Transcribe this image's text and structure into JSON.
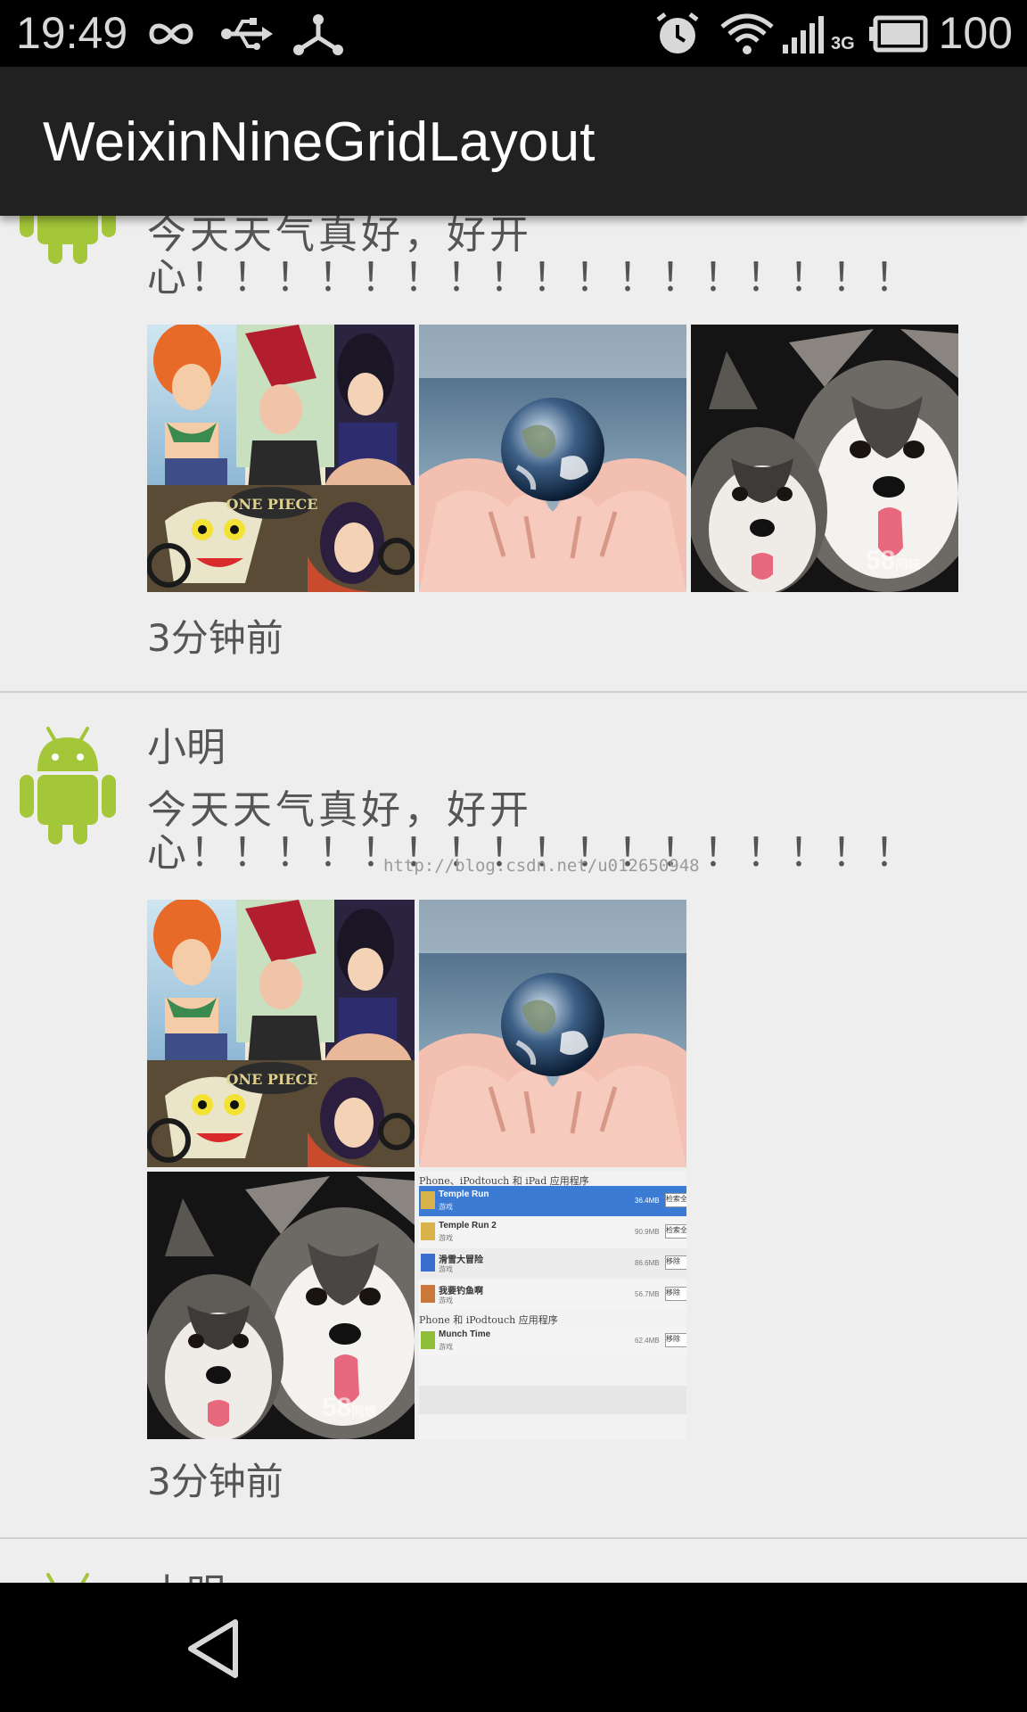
{
  "status_bar": {
    "time": "19:49",
    "battery_level": "100",
    "network_type": "3G",
    "icons": [
      "infinity-icon",
      "usb-icon",
      "share-icon",
      "alarm-icon",
      "wifi-icon",
      "signal-icon",
      "battery-icon"
    ]
  },
  "app_bar": {
    "title": "WeixinNineGridLayout"
  },
  "posts": [
    {
      "name": "",
      "content": "今天天气真好，好开心！！！！！！！！！！！！！！！！！",
      "time": "3分钟前",
      "images": [
        "anime-collage-image",
        "earth-in-hands-image",
        "husky-puppies-image"
      ]
    },
    {
      "name": "小明",
      "content": "今天天气真好，好开心！！！！！！！！！！！！！！！！！",
      "time": "3分钟前",
      "images": [
        "anime-collage-image",
        "earth-in-hands-image",
        "husky-puppies-image",
        "app-store-list-image"
      ]
    },
    {
      "name": "小明"
    }
  ],
  "watermark": "http://blog.csdn.net/u012650948",
  "puppy_watermark": "58",
  "puppy_watermark_sub": "同城",
  "puppy_watermark_dom": ".com",
  "app_list": {
    "header_1": "Phone、iPodtouch 和 iPad 应用程序",
    "header_2": "Phone 和 iPodtouch 应用程序",
    "items": [
      {
        "name": "Temple Run",
        "category": "游戏",
        "size": "36.4MB",
        "action": "检索全部",
        "selected": true
      },
      {
        "name": "Temple Run 2",
        "category": "游戏",
        "size": "90.9MB",
        "action": "检索全部",
        "selected": false
      },
      {
        "name": "滑雪大冒险",
        "category": "游戏",
        "size": "86.6MB",
        "action": "移除",
        "selected": false
      },
      {
        "name": "我要钓鱼啊",
        "category": "游戏",
        "size": "56.7MB",
        "action": "移除",
        "selected": false
      }
    ],
    "item_2": {
      "name": "Munch Time",
      "category": "游戏",
      "size": "62.4MB",
      "action": "移除"
    }
  },
  "colors": {
    "app_bar": "#212121",
    "background": "#eeeeee",
    "android_green": "#a4c639",
    "selection_blue": "#3b7bd4"
  }
}
